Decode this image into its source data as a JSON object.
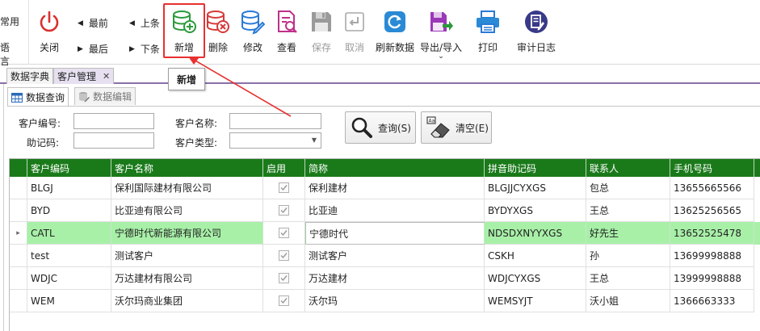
{
  "ribbon": {
    "lang_top": "常用",
    "lang_bottom": "语言",
    "close": "关闭",
    "nav_first": "最前",
    "nav_prev": "上条",
    "nav_last": "最后",
    "nav_next": "下条",
    "add": "新增",
    "delete": "删除",
    "edit": "修改",
    "view": "查看",
    "save": "保存",
    "cancel": "取消",
    "refresh": "刷新数据",
    "export_import": "导出/导入",
    "print": "打印",
    "audit_log": "审计日志"
  },
  "tooltip": "新增",
  "doc_tabs": [
    {
      "label": "数据字典"
    },
    {
      "label": "客户管理"
    }
  ],
  "sub_tabs": [
    {
      "label": "数据查询"
    },
    {
      "label": "数据编辑"
    }
  ],
  "form": {
    "code_label": "客户编号:",
    "name_label": "客户名称:",
    "mnemonic_label": "助记码:",
    "type_label": "客户类型:",
    "code_value": "",
    "name_value": "",
    "mnemonic_value": "",
    "type_value": ""
  },
  "actions": {
    "query": "查询(S)",
    "clear": "清空(E)"
  },
  "grid": {
    "columns": [
      "客户编码",
      "客户名称",
      "启用",
      "简称",
      "拼音助记码",
      "联系人",
      "手机号码"
    ],
    "rows": [
      {
        "code": "BLGJ",
        "name": "保利国际建材有限公司",
        "enabled": true,
        "short": "保利建材",
        "pinyin": "BLGJJCYXGS",
        "contact": "包总",
        "phone": "13655665566",
        "selected": false
      },
      {
        "code": "BYD",
        "name": "比亚迪有限公司",
        "enabled": true,
        "short": "比亚迪",
        "pinyin": "BYDYXGS",
        "contact": "王总",
        "phone": "13625256565",
        "selected": false
      },
      {
        "code": "CATL",
        "name": "宁德时代新能源有限公司",
        "enabled": true,
        "short": "宁德时代",
        "pinyin": "NDSDXNYYXGS",
        "contact": "好先生",
        "phone": "13652525478",
        "selected": true
      },
      {
        "code": "test",
        "name": "测试客户",
        "enabled": true,
        "short": "测试客户",
        "pinyin": "CSKH",
        "contact": "孙",
        "phone": "13699998888",
        "selected": false
      },
      {
        "code": "WDJC",
        "name": "万达建材有限公司",
        "enabled": true,
        "short": "万达建材",
        "pinyin": "WDJCYXGS",
        "contact": "王总",
        "phone": "13999998888",
        "selected": false
      },
      {
        "code": "WEM",
        "name": "沃尔玛商业集团",
        "enabled": true,
        "short": "沃尔玛",
        "pinyin": "WEMSYJT",
        "contact": "沃小姐",
        "phone": "1366663333",
        "selected": false
      }
    ]
  },
  "colors": {
    "header_green": "#1a7a1a",
    "selected_row": "#a8f0a8",
    "highlight_red": "#e83030",
    "tab_accent": "#8a6fa8"
  }
}
